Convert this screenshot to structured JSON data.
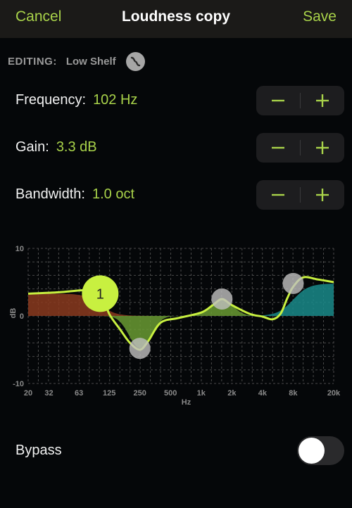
{
  "nav": {
    "cancel": "Cancel",
    "title": "Loudness copy",
    "save": "Save"
  },
  "editing": {
    "label": "EDITING:",
    "value": "Low Shelf",
    "icon": "low-shelf-curve-icon"
  },
  "params": [
    {
      "label": "Frequency:",
      "value": "102 Hz",
      "minus": "−",
      "plus": "+"
    },
    {
      "label": "Gain:",
      "value": "3.3 dB",
      "minus": "−",
      "plus": "+"
    },
    {
      "label": "Bandwidth:",
      "value": "1.0 oct",
      "minus": "−",
      "plus": "+"
    }
  ],
  "colors": {
    "accent": "#a9d34a",
    "band1": "#8b3a1e",
    "band2": "#6a9a32",
    "band3": "#1a8a8a",
    "curve": "#c8f040",
    "handle": "#c0c0c0"
  },
  "chart_data": {
    "type": "line",
    "title": "",
    "xlabel": "Hz",
    "ylabel": "dB",
    "xscale": "log",
    "xlim": [
      20,
      20000
    ],
    "ylim": [
      -10,
      10
    ],
    "y_ticks": [
      "10",
      "0",
      "-10"
    ],
    "y_tick_values": [
      10,
      0,
      -10
    ],
    "x_ticks": [
      "20",
      "32",
      "63",
      "125",
      "250",
      "500",
      "1k",
      "2k",
      "4k",
      "8k",
      "20k"
    ],
    "x_tick_values": [
      20,
      32,
      63,
      125,
      250,
      500,
      1000,
      2000,
      4000,
      8000,
      20000
    ],
    "grid": true,
    "bands": [
      {
        "id": "1",
        "type": "low-shelf",
        "freq": 102,
        "gain": 3.3,
        "bw": 1.0,
        "selected": true
      },
      {
        "id": "2",
        "type": "peak",
        "freq": 250,
        "gain": -4.8,
        "bw": 1.0,
        "selected": false
      },
      {
        "id": "3",
        "type": "peak",
        "freq": 1600,
        "gain": 2.5,
        "bw": 1.0,
        "selected": false
      },
      {
        "id": "4",
        "type": "high-shelf",
        "freq": 8000,
        "gain": 4.8,
        "bw": 1.0,
        "selected": false
      }
    ],
    "curve": [
      [
        20,
        3.3
      ],
      [
        40,
        3.5
      ],
      [
        70,
        3.8
      ],
      [
        102,
        3.6
      ],
      [
        125,
        0.3
      ],
      [
        160,
        -2.0
      ],
      [
        200,
        -4.0
      ],
      [
        250,
        -5.0
      ],
      [
        300,
        -3.8
      ],
      [
        400,
        -1.0
      ],
      [
        600,
        -0.3
      ],
      [
        1000,
        0.5
      ],
      [
        1300,
        1.6
      ],
      [
        1600,
        2.5
      ],
      [
        2000,
        1.6
      ],
      [
        3000,
        0.3
      ],
      [
        4000,
        -0.1
      ],
      [
        5000,
        -0.5
      ],
      [
        6000,
        0.3
      ],
      [
        7000,
        2.6
      ],
      [
        8000,
        4.3
      ],
      [
        10000,
        5.7
      ],
      [
        14000,
        5.4
      ],
      [
        20000,
        5.0
      ]
    ]
  },
  "bypass": {
    "label": "Bypass",
    "on": false
  }
}
